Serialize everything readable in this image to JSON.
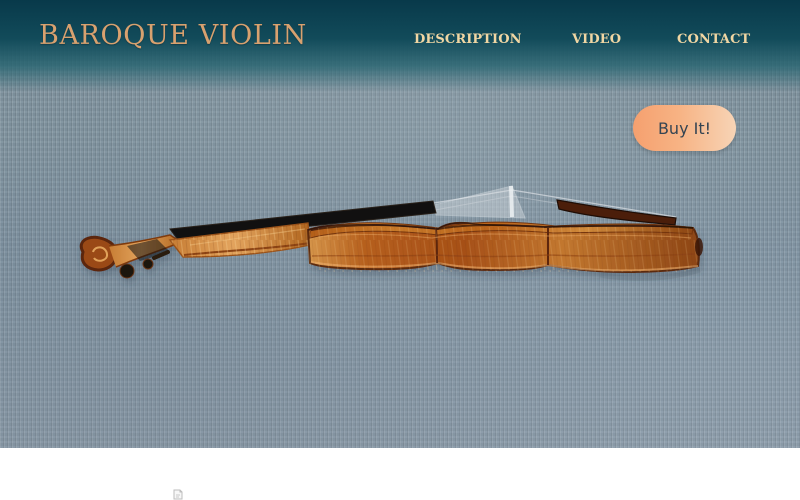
{
  "header": {
    "brand": "Baroque Violin",
    "nav": {
      "description": "DESCRIPTION",
      "video": "VIDEO",
      "contact": "CONTACT"
    }
  },
  "hero": {
    "buy_label": "Buy It!"
  },
  "colors": {
    "brand": "#d8a16f",
    "nav": "#f0d6a3",
    "button_start": "#f5a06f",
    "button_end": "#f7d4b6"
  },
  "icons": {
    "bottom_icon": "small-document-icon"
  }
}
